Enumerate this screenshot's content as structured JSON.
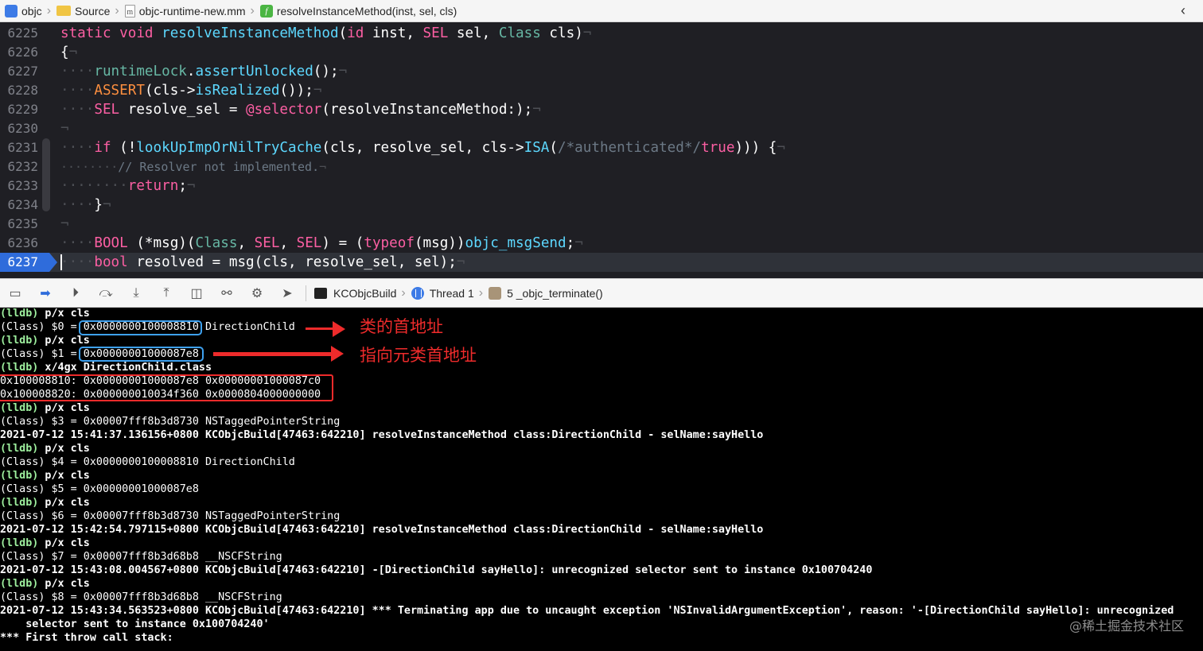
{
  "jumpbar": {
    "crumbs": [
      "objc",
      "Source",
      "objc-runtime-new.mm",
      "resolveInstanceMethod(inst, sel, cls)"
    ]
  },
  "editor": {
    "lines": [
      {
        "num": "6225"
      },
      {
        "num": "6226"
      },
      {
        "num": "6227"
      },
      {
        "num": "6228"
      },
      {
        "num": "6229"
      },
      {
        "num": "6230"
      },
      {
        "num": "6231"
      },
      {
        "num": "6232"
      },
      {
        "num": "6233"
      },
      {
        "num": "6234"
      },
      {
        "num": "6235"
      },
      {
        "num": "6236"
      },
      {
        "num": "6237"
      }
    ],
    "current_line": "6237"
  },
  "debugbar": {
    "target": "KCObjcBuild",
    "thread": "Thread 1",
    "frame": "5 _objc_terminate()"
  },
  "console": {
    "lines": [
      "(lldb) p/x cls",
      "(Class) $0 = 0x0000000100008810 DirectionChild",
      "(lldb) p/x cls",
      "(Class) $1 = 0x00000001000087e8",
      "(lldb) x/4gx DirectionChild.class",
      "0x100008810: 0x00000001000087e8 0x00000001000087c0",
      "0x100008820: 0x000000010034f360 0x0000804000000000",
      "(lldb) p/x cls",
      "(Class) $3 = 0x00007fff8b3d8730 NSTaggedPointerString",
      "2021-07-12 15:41:37.136156+0800 KCObjcBuild[47463:642210] resolveInstanceMethod class:DirectionChild - selName:sayHello",
      "(lldb) p/x cls",
      "(Class) $4 = 0x0000000100008810 DirectionChild",
      "(lldb) p/x cls",
      "(Class) $5 = 0x00000001000087e8",
      "(lldb) p/x cls",
      "(Class) $6 = 0x00007fff8b3d8730 NSTaggedPointerString",
      "2021-07-12 15:42:54.797115+0800 KCObjcBuild[47463:642210] resolveInstanceMethod class:DirectionChild - selName:sayHello",
      "(lldb) p/x cls",
      "(Class) $7 = 0x00007fff8b3d68b8 __NSCFString",
      "2021-07-12 15:43:08.004567+0800 KCObjcBuild[47463:642210] -[DirectionChild sayHello]: unrecognized selector sent to instance 0x100704240",
      "(lldb) p/x cls",
      "(Class) $8 = 0x00007fff8b3d68b8 __NSCFString",
      "2021-07-12 15:43:34.563523+0800 KCObjcBuild[47463:642210] *** Terminating app due to uncaught exception 'NSInvalidArgumentException', reason: '-[DirectionChild sayHello]: unrecognized",
      "    selector sent to instance 0x100704240'",
      "*** First throw call stack:"
    ]
  },
  "annotations": {
    "first": "类的首地址",
    "second": "指向元类首地址"
  },
  "watermark": "@稀土掘金技术社区",
  "colors": {
    "annotation_red": "#ee2b2b",
    "highlight_blue": "#3ea1f0",
    "editor_bg": "#1f1f24",
    "keyword": "#fc5fa3",
    "exec_marker": "#2f6cdb"
  }
}
